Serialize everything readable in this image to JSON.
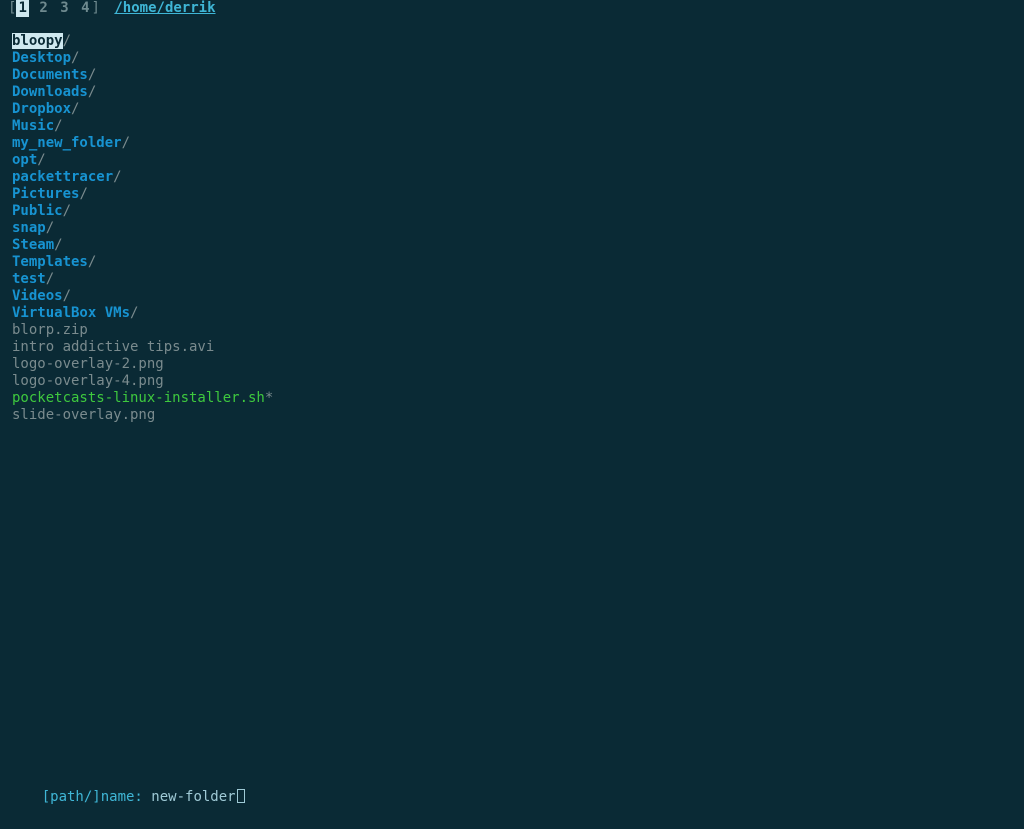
{
  "topbar": {
    "bracket_open": "[",
    "bracket_close": "]",
    "tabs": [
      "1",
      "2",
      "3",
      "4"
    ],
    "active_index": 0,
    "path": "/home/derrik"
  },
  "listing": [
    {
      "name": "bloopy",
      "type": "dir",
      "selected": true
    },
    {
      "name": "Desktop",
      "type": "dir"
    },
    {
      "name": "Documents",
      "type": "dir"
    },
    {
      "name": "Downloads",
      "type": "dir"
    },
    {
      "name": "Dropbox",
      "type": "dir"
    },
    {
      "name": "Music",
      "type": "dir"
    },
    {
      "name": "my_new_folder",
      "type": "dir"
    },
    {
      "name": "opt",
      "type": "dir"
    },
    {
      "name": "packettracer",
      "type": "dir"
    },
    {
      "name": "Pictures",
      "type": "dir"
    },
    {
      "name": "Public",
      "type": "dir"
    },
    {
      "name": "snap",
      "type": "dir"
    },
    {
      "name": "Steam",
      "type": "dir"
    },
    {
      "name": "Templates",
      "type": "dir"
    },
    {
      "name": "test",
      "type": "dir"
    },
    {
      "name": "Videos",
      "type": "dir"
    },
    {
      "name": "VirtualBox VMs",
      "type": "dir"
    },
    {
      "name": "blorp.zip",
      "type": "file"
    },
    {
      "name": "intro addictive tips.avi",
      "type": "file"
    },
    {
      "name": "logo-overlay-2.png",
      "type": "file"
    },
    {
      "name": "logo-overlay-4.png",
      "type": "file"
    },
    {
      "name": "pocketcasts-linux-installer.sh",
      "type": "exec"
    },
    {
      "name": "slide-overlay.png",
      "type": "file"
    }
  ],
  "prompt": {
    "label": "[path/]name: ",
    "value": "new-folder"
  },
  "glyphs": {
    "dir_suffix": "/",
    "exec_suffix": "*"
  }
}
